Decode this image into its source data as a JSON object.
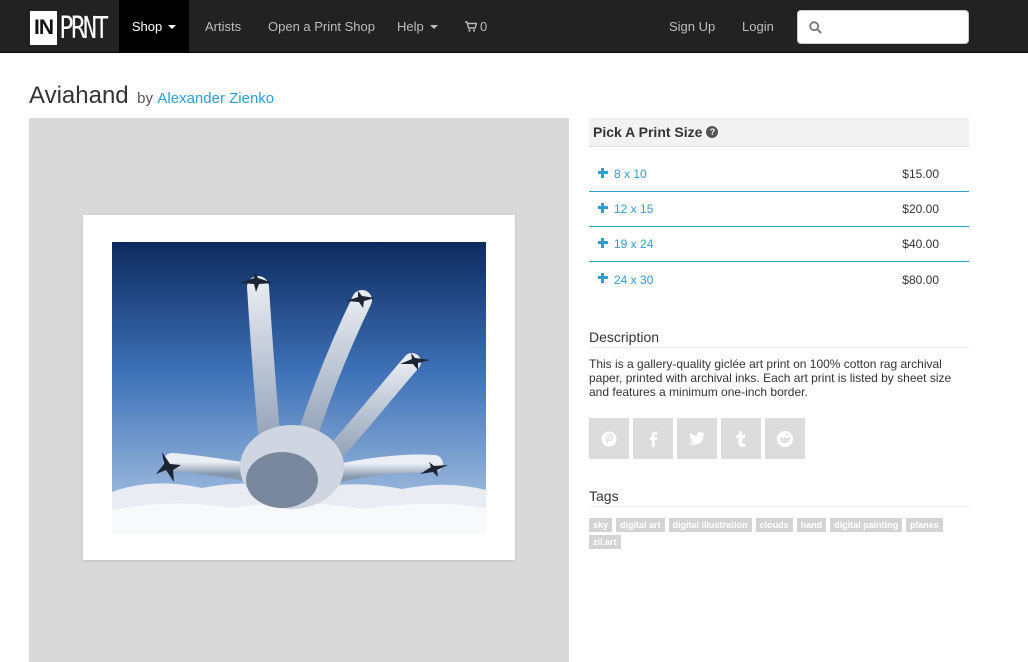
{
  "nav": {
    "logo_in": "IN",
    "logo_prnt": "PRNT",
    "shop": "Shop",
    "artists": "Artists",
    "open_shop": "Open a Print Shop",
    "help": "Help",
    "cart_count": "0",
    "sign_up": "Sign Up",
    "login": "Login",
    "search_value": "",
    "search_icon": "search-icon",
    "cart_icon": "cart-icon"
  },
  "product": {
    "title": "Aviahand",
    "by": "by",
    "artist": "Alexander Zienko"
  },
  "sizes": {
    "header": "Pick A Print Size",
    "help_icon": "question-circle-icon",
    "options": [
      {
        "label": "8 x 10",
        "price": "$15.00"
      },
      {
        "label": "12 x 15",
        "price": "$20.00"
      },
      {
        "label": "19 x 24",
        "price": "$40.00"
      },
      {
        "label": "24 x 30",
        "price": "$80.00"
      }
    ]
  },
  "description": {
    "heading": "Description",
    "text": "This is a gallery-quality giclée art print on 100% cotton rag archival paper, printed with archival inks. Each art print is listed by sheet size and features a minimum one-inch border."
  },
  "share": [
    "pinterest-icon",
    "facebook-icon",
    "twitter-icon",
    "tumblr-icon",
    "reddit-icon"
  ],
  "tags": {
    "heading": "Tags",
    "items": [
      "sky",
      "digital art",
      "digital illustration",
      "clouds",
      "hand",
      "digital painting",
      "planes",
      "zil.art"
    ]
  },
  "colors": {
    "accent": "#2a9fd6",
    "navbar": "#222222",
    "panel": "#d9d9d9",
    "tag": "#d4d4d4"
  }
}
